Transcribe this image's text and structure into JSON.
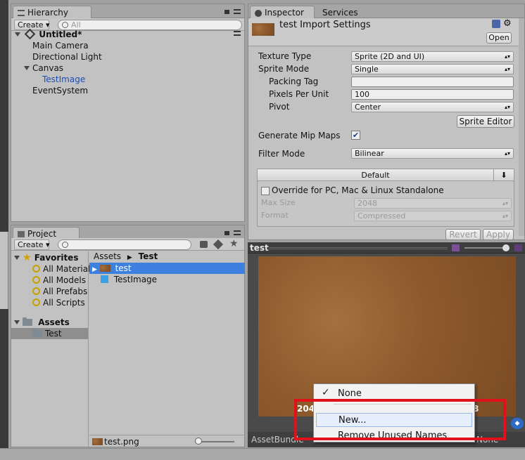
{
  "hierarchy": {
    "tab_label": "Hierarchy",
    "create_label": "Create",
    "search_placeholder": "All",
    "scene_name": "Untitled*",
    "items": [
      {
        "label": "Main Camera"
      },
      {
        "label": "Directional Light"
      },
      {
        "label": "Canvas"
      },
      {
        "label": "TestImage"
      },
      {
        "label": "EventSystem"
      }
    ]
  },
  "project": {
    "tab_label": "Project",
    "create_label": "Create",
    "favorites_label": "Favorites",
    "favorites": [
      "All Material",
      "All Models",
      "All Prefabs",
      "All Scripts"
    ],
    "assets_label": "Assets",
    "assets_children": [
      "Test"
    ],
    "breadcrumb": [
      "Assets",
      "Test"
    ],
    "files": [
      "test",
      "TestImage"
    ],
    "footer_file": "test.png"
  },
  "inspector": {
    "tab_label": "Inspector",
    "services_tab_label": "Services",
    "title": "test Import Settings",
    "open_label": "Open",
    "fields": {
      "texture_type_label": "Texture Type",
      "texture_type_value": "Sprite (2D and UI)",
      "sprite_mode_label": "Sprite Mode",
      "sprite_mode_value": "Single",
      "packing_tag_label": "Packing Tag",
      "packing_tag_value": "",
      "ppu_label": "Pixels Per Unit",
      "ppu_value": "100",
      "pivot_label": "Pivot",
      "pivot_value": "Center",
      "sprite_editor_label": "Sprite Editor",
      "mipmaps_label": "Generate Mip Maps",
      "filter_mode_label": "Filter Mode",
      "filter_mode_value": "Bilinear"
    },
    "platform": {
      "default_label": "Default",
      "override_label": "Override for PC, Mac & Linux Standalone",
      "max_size_label": "Max Size",
      "max_size_value": "2048",
      "format_label": "Format",
      "format_value": "Compressed"
    },
    "revert_label": "Revert",
    "apply_label": "Apply"
  },
  "preview": {
    "title": "test",
    "size_text_left": "204",
    "size_text_right": "8",
    "assetbundle_label": "AssetBundle",
    "assetbundle_value_tail": "None"
  },
  "context_menu": {
    "items": [
      {
        "label": "None",
        "checked": true
      },
      {
        "label": "New...",
        "checked": false
      },
      {
        "label": "Remove Unused Names",
        "checked": false
      }
    ]
  },
  "colors": {
    "selection": "#3d80df",
    "highlight_box": "#e0111b",
    "panel_bg": "#c2c2c2"
  }
}
